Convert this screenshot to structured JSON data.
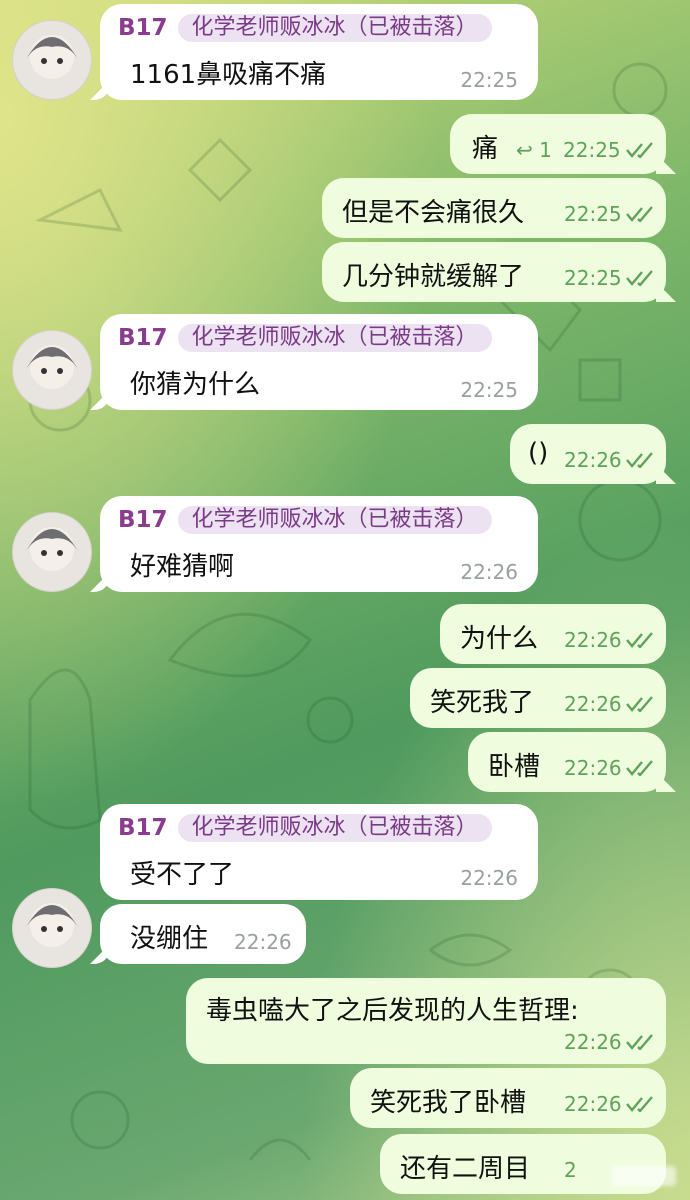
{
  "chat": {
    "sender_name": "B17",
    "sender_tag": "化学老师贩冰冰（已被击落）",
    "messages": [
      {
        "text": "1161鼻吸痛不痛",
        "time": "22:25"
      },
      {
        "text": "痛",
        "time": "22:25",
        "reply_count": "1"
      },
      {
        "text": "但是不会痛很久",
        "time": "22:25"
      },
      {
        "text": "几分钟就缓解了",
        "time": "22:25"
      },
      {
        "text": "你猜为什么",
        "time": "22:25"
      },
      {
        "text": "()",
        "time": "22:26"
      },
      {
        "text": "好难猜啊",
        "time": "22:26"
      },
      {
        "text": "为什么",
        "time": "22:26"
      },
      {
        "text": "笑死我了",
        "time": "22:26"
      },
      {
        "text": "卧槽",
        "time": "22:26"
      },
      {
        "text": "受不了了",
        "time": "22:26"
      },
      {
        "text": "没绷住",
        "time": "22:26"
      },
      {
        "text": "毒虫嗑大了之后发现的人生哲理:",
        "time": "22:26"
      },
      {
        "text": "笑死我了卧槽",
        "time": "22:26"
      },
      {
        "text": "还有二周目",
        "time": "2"
      }
    ]
  },
  "colors": {
    "accent": "#8a3c8f",
    "outgoing_bubble": "#effdde",
    "check": "#5fa35a"
  }
}
